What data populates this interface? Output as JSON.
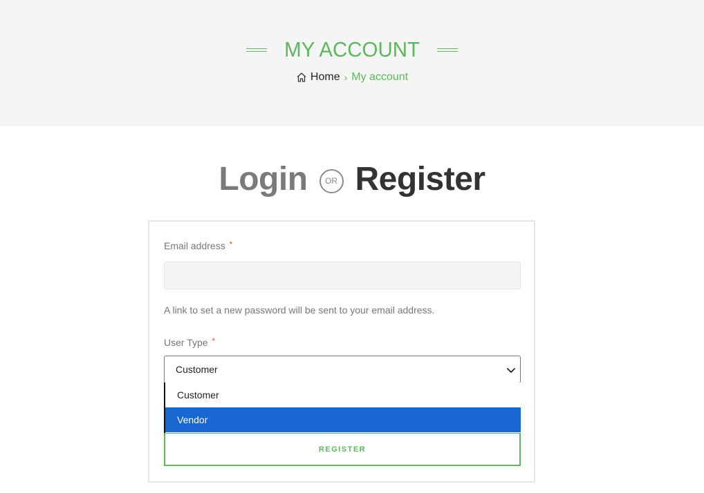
{
  "header": {
    "title": "MY ACCOUNT",
    "breadcrumb": {
      "home_label": "Home",
      "separator": "›",
      "current": "My account"
    }
  },
  "auth": {
    "login_label": "Login",
    "or_label": "OR",
    "register_label": "Register"
  },
  "form": {
    "email_label": "Email address",
    "required_mark": "*",
    "email_value": "",
    "help_text": "A link to set a new password will be sent to your email address.",
    "user_type_label": "User Type",
    "user_type_selected": "Customer",
    "user_type_options": [
      "Customer",
      "Vendor"
    ],
    "highlighted_option": "Vendor",
    "register_button": "REGISTER"
  },
  "colors": {
    "accent_green": "#5cb85c",
    "selection_blue": "#1967d2",
    "header_bg": "#f5f5f5"
  },
  "icons": {
    "home": "home-icon",
    "chevron": "chevron-down-icon"
  }
}
